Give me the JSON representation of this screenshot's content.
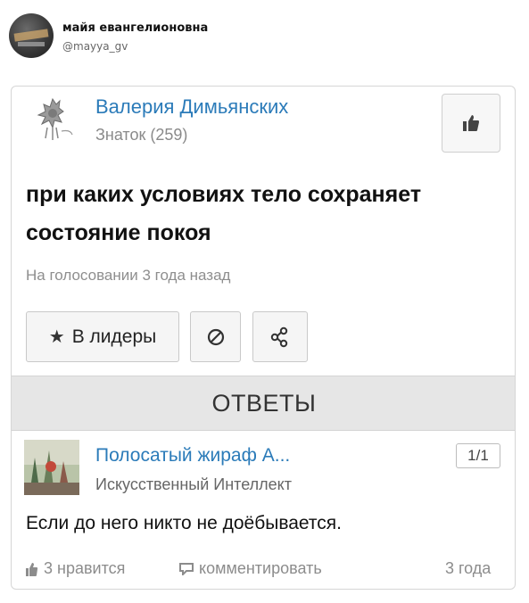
{
  "tweet": {
    "name": "майя евангелионовна",
    "handle": "@mayya_gv"
  },
  "question": {
    "author": "Валерия Димьянских",
    "rank": "Знаток (259)",
    "text": "при каких условиях тело сохраняет состояние покоя",
    "status": "На голосовании 3 года назад",
    "leaders_button": "В лидеры"
  },
  "answers_header": "ОТВЕТЫ",
  "answer": {
    "author": "Полосатый жираф А...",
    "rank": "Искусственный Интеллект",
    "rating": "1/1",
    "text": "Если до него никто не доёбывается.",
    "likes": "3 нравится",
    "comment": "комментировать",
    "time": "3 года"
  },
  "colors": {
    "link_blue": "#2b7bb9",
    "muted_gray": "#8e8e8e",
    "bar_gray": "#e6e6e6"
  }
}
